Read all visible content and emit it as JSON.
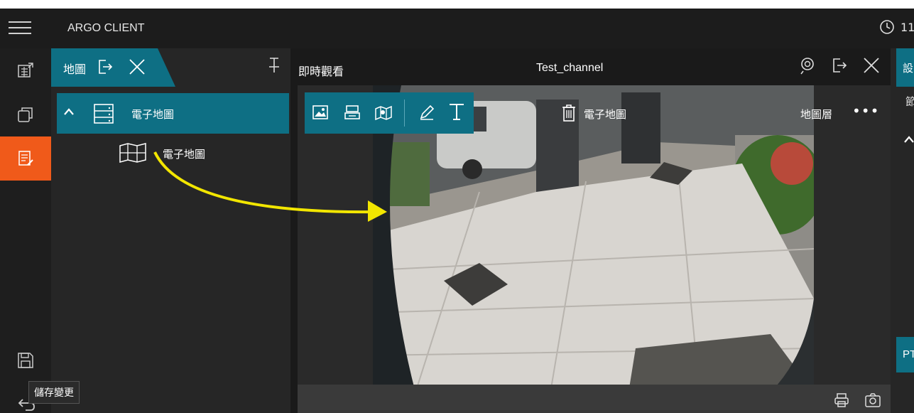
{
  "header": {
    "app_title": "ARGO CLIENT",
    "clock_text": "11"
  },
  "map_panel": {
    "tab_label": "地圖",
    "tree_group_label": "電子地圖",
    "tree_child_label": "電子地圖"
  },
  "live_view": {
    "title": "即時觀看",
    "channel": "Test_channel",
    "delete_label": "電子地圖",
    "layer_label": "地圖層",
    "more_label": "•••"
  },
  "right_panel": {
    "tab_label": "設",
    "sub_label": "節",
    "pt_label": "PT"
  },
  "tooltip": {
    "text": "儲存變更"
  },
  "colors": {
    "accent": "#0e6f84",
    "active_rail": "#f05a1a",
    "arrow": "#f2e600"
  }
}
